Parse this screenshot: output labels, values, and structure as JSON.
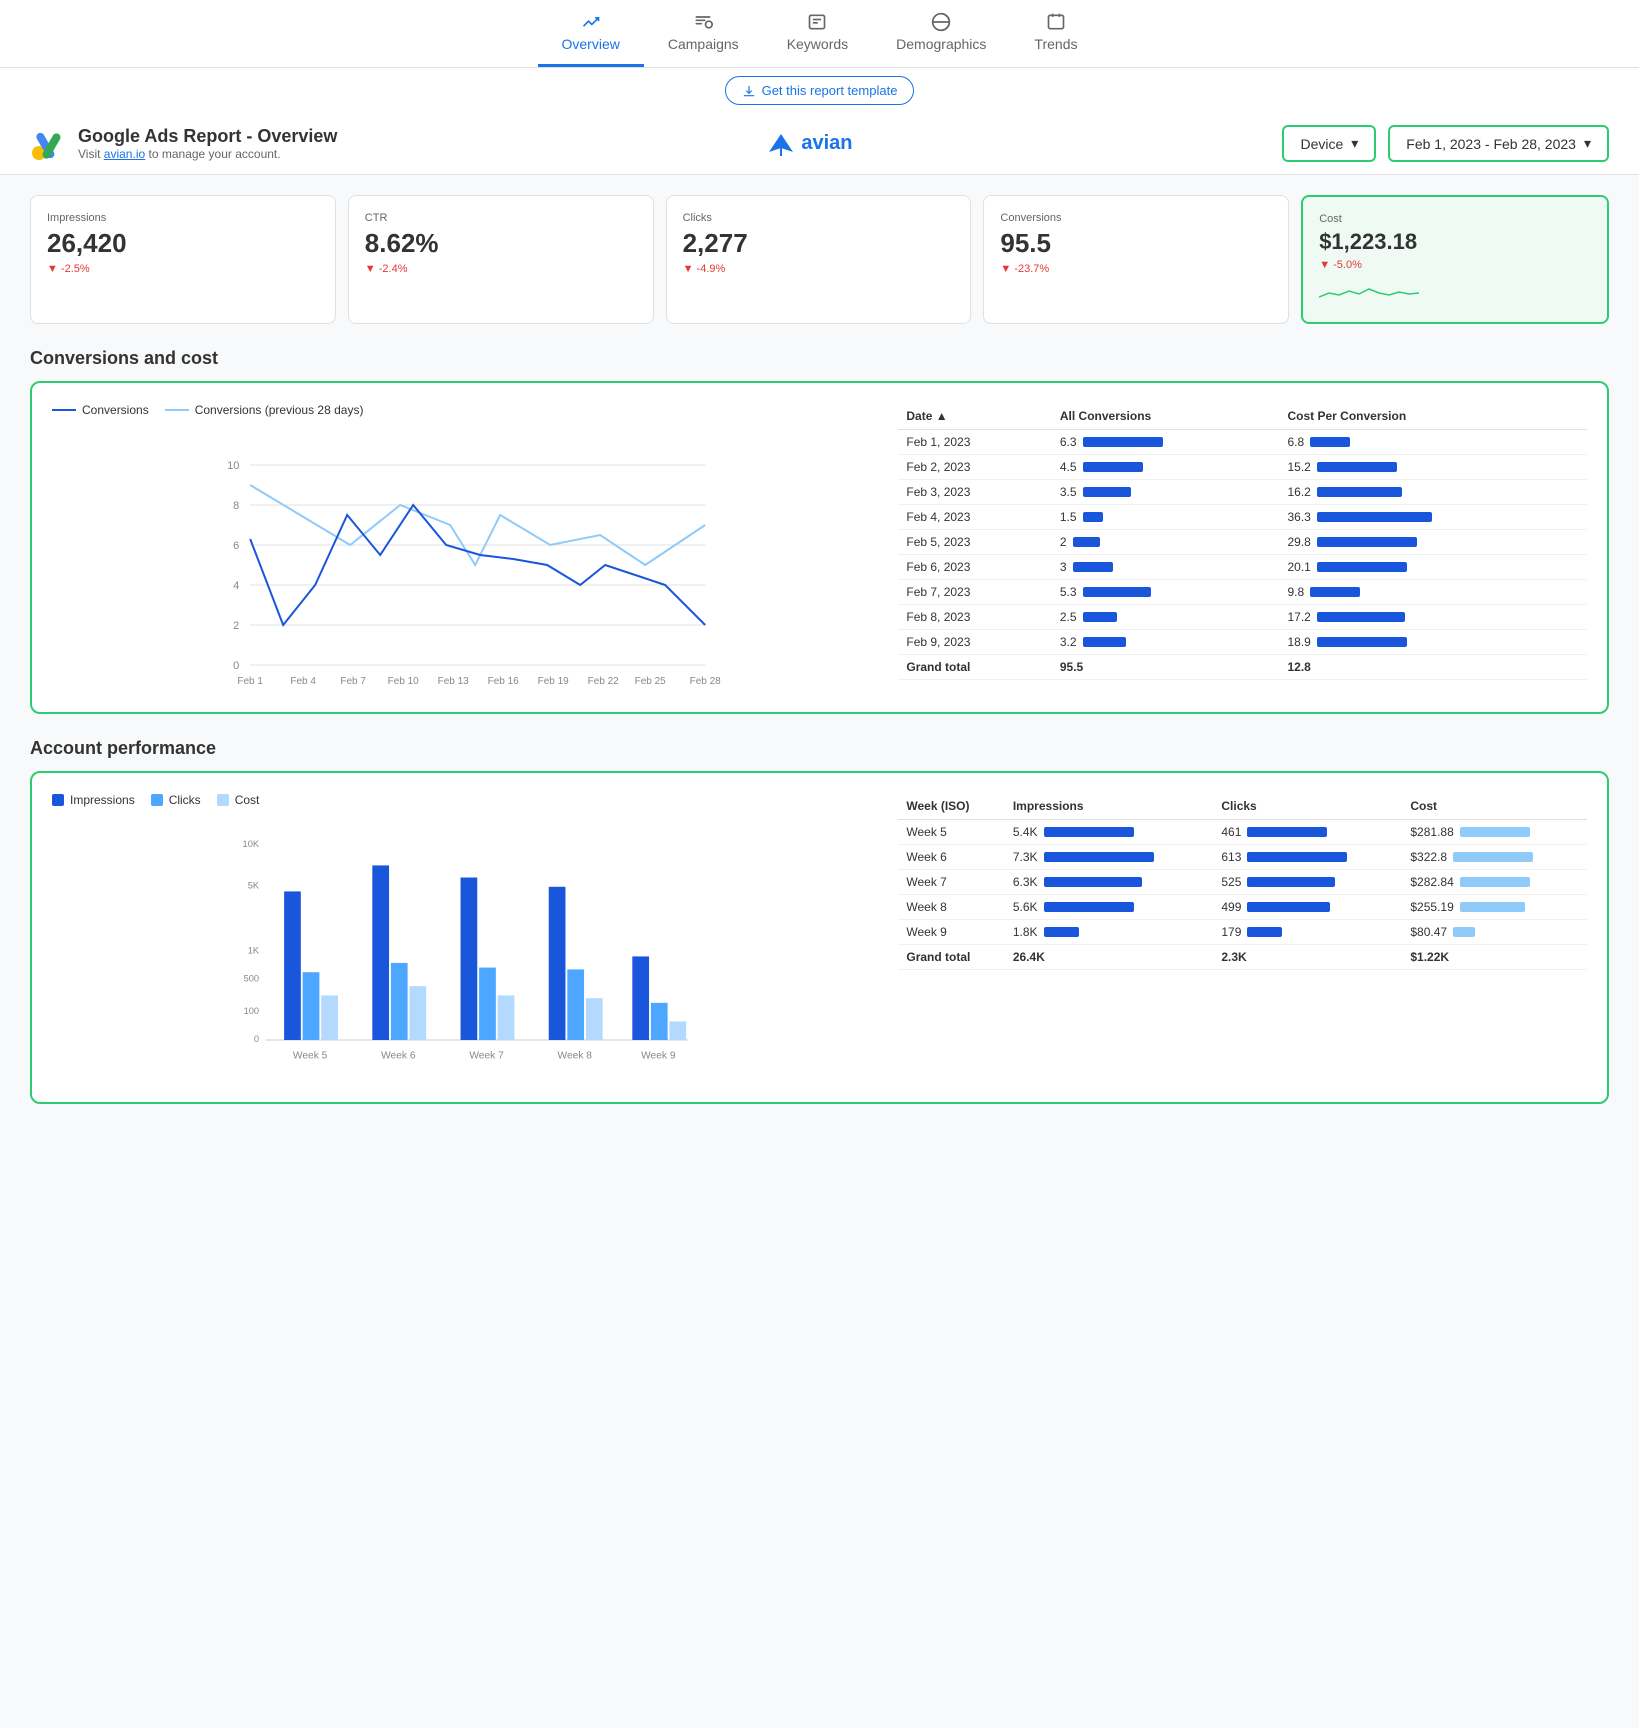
{
  "nav": {
    "items": [
      {
        "label": "Overview",
        "active": true
      },
      {
        "label": "Campaigns",
        "active": false
      },
      {
        "label": "Keywords",
        "active": false
      },
      {
        "label": "Demographics",
        "active": false
      },
      {
        "label": "Trends",
        "active": false
      }
    ]
  },
  "template_banner": {
    "button_label": "Get this report template"
  },
  "header": {
    "report_title": "Google Ads Report - Overview",
    "report_subtitle": "Visit",
    "report_link_text": "avian.io",
    "report_link_suffix": " to manage your account.",
    "brand_name": "avian",
    "device_label": "Device",
    "date_range": "Feb 1, 2023 - Feb 28, 2023"
  },
  "metrics": [
    {
      "label": "Impressions",
      "value": "26,420",
      "change": "▼ -2.5%",
      "highlighted": false
    },
    {
      "label": "CTR",
      "value": "8.62%",
      "change": "▼ -2.4%",
      "highlighted": false
    },
    {
      "label": "Clicks",
      "value": "2,277",
      "change": "▼ -4.9%",
      "highlighted": false
    },
    {
      "label": "Conversions",
      "value": "95.5",
      "change": "▼ -23.7%",
      "highlighted": false
    },
    {
      "label": "Cost",
      "value": "$1,223.18",
      "change": "▼ -5.0%",
      "highlighted": true
    }
  ],
  "conversions_section": {
    "title": "Conversions and cost",
    "legend": [
      {
        "label": "Conversions",
        "style": "dark"
      },
      {
        "label": "Conversions (previous 28 days)",
        "style": "light"
      }
    ],
    "x_labels": [
      "Feb 1",
      "Feb 4",
      "Feb 7",
      "Feb 10",
      "Feb 13",
      "Feb 16",
      "Feb 19",
      "Feb 22",
      "Feb 25",
      "Feb 28"
    ],
    "y_labels": [
      "0",
      "2",
      "4",
      "6",
      "8",
      "10"
    ],
    "table": {
      "headers": [
        "Date ▲",
        "All Conversions",
        "Cost Per Conversion"
      ],
      "rows": [
        {
          "date": "Feb 1, 2023",
          "conversions": 6.3,
          "conv_bar_w": 80,
          "cost": 6.8,
          "cost_bar_w": 40
        },
        {
          "date": "Feb 2, 2023",
          "conversions": 4.5,
          "conv_bar_w": 60,
          "cost": 15.2,
          "cost_bar_w": 80
        },
        {
          "date": "Feb 3, 2023",
          "conversions": 3.5,
          "conv_bar_w": 48,
          "cost": 16.2,
          "cost_bar_w": 85
        },
        {
          "date": "Feb 4, 2023",
          "conversions": 1.5,
          "conv_bar_w": 20,
          "cost": 36.3,
          "cost_bar_w": 115
        },
        {
          "date": "Feb 5, 2023",
          "conversions": 2,
          "conv_bar_w": 27,
          "cost": 29.8,
          "cost_bar_w": 100
        },
        {
          "date": "Feb 6, 2023",
          "conversions": 3,
          "conv_bar_w": 40,
          "cost": 20.1,
          "cost_bar_w": 90
        },
        {
          "date": "Feb 7, 2023",
          "conversions": 5.3,
          "conv_bar_w": 68,
          "cost": 9.8,
          "cost_bar_w": 50
        },
        {
          "date": "Feb 8, 2023",
          "conversions": 2.5,
          "conv_bar_w": 34,
          "cost": 17.2,
          "cost_bar_w": 88
        },
        {
          "date": "Feb 9, 2023",
          "conversions": 3.2,
          "conv_bar_w": 43,
          "cost": 18.9,
          "cost_bar_w": 90
        }
      ],
      "grand_total": {
        "label": "Grand total",
        "conversions": "95.5",
        "cost": "12.8"
      }
    }
  },
  "account_section": {
    "title": "Account performance",
    "legend": [
      {
        "label": "Impressions",
        "style": "dark"
      },
      {
        "label": "Clicks",
        "style": "mid"
      },
      {
        "label": "Cost",
        "style": "light"
      }
    ],
    "y_labels": [
      "10K",
      "5K",
      "1K",
      "500",
      "100",
      "0"
    ],
    "x_labels": [
      "Week 5",
      "Week 6",
      "Week 7",
      "Week 8",
      "Week 9"
    ],
    "table": {
      "headers": [
        "Week (ISO)",
        "Impressions",
        "Clicks",
        "Cost"
      ],
      "rows": [
        {
          "week": "Week 5",
          "impressions": "5.4K",
          "imp_bar_w": 90,
          "clicks": "461",
          "click_bar_w": 80,
          "cost": "$281.88",
          "cost_bar_w": 70
        },
        {
          "week": "Week 6",
          "impressions": "7.3K",
          "imp_bar_w": 110,
          "clicks": "613",
          "click_bar_w": 100,
          "cost": "$322.8",
          "cost_bar_w": 80
        },
        {
          "week": "Week 7",
          "impressions": "6.3K",
          "imp_bar_w": 98,
          "clicks": "525",
          "click_bar_w": 88,
          "cost": "$282.84",
          "cost_bar_w": 70
        },
        {
          "week": "Week 8",
          "impressions": "5.6K",
          "imp_bar_w": 90,
          "clicks": "499",
          "click_bar_w": 83,
          "cost": "$255.19",
          "cost_bar_w": 65
        },
        {
          "week": "Week 9",
          "impressions": "1.8K",
          "imp_bar_w": 35,
          "clicks": "179",
          "click_bar_w": 35,
          "cost": "$80.47",
          "cost_bar_w": 22
        }
      ],
      "grand_total": {
        "label": "Grand total",
        "impressions": "26.4K",
        "clicks": "2.3K",
        "cost": "$1.22K"
      }
    }
  }
}
